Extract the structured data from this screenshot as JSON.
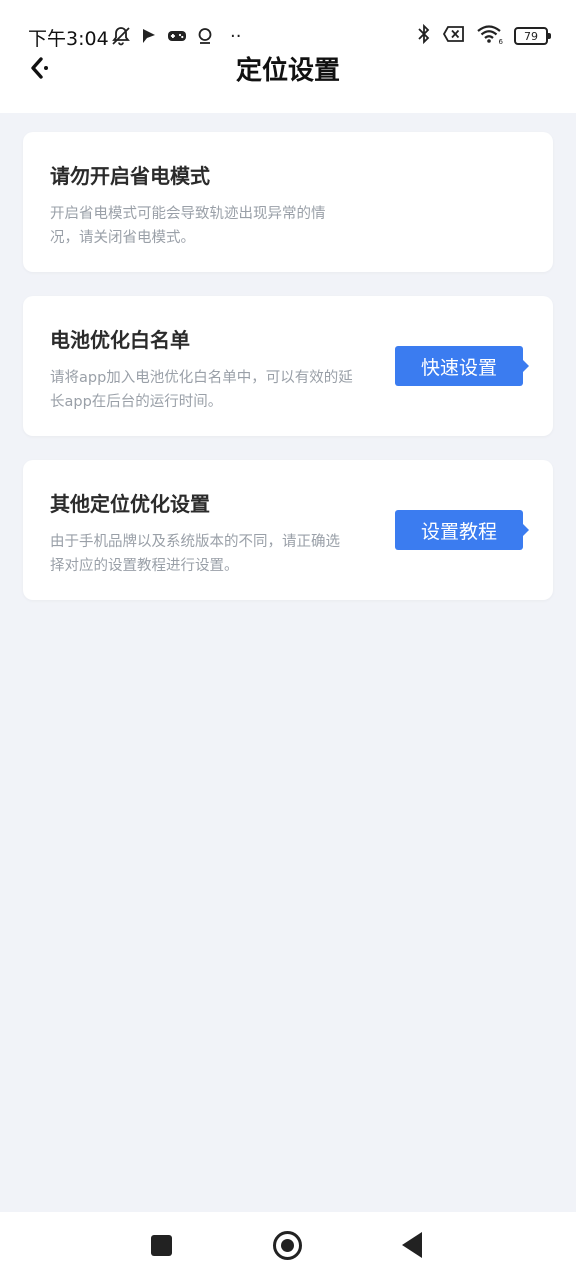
{
  "status_bar": {
    "time": "下午3:04",
    "more": "··",
    "battery_level": "79"
  },
  "header": {
    "title": "定位设置"
  },
  "cards": [
    {
      "title": "请勿开启省电模式",
      "desc_lines": [
        "开启省电模式可能会导致轨迹出现异常的情",
        "况，请关闭省电模式。"
      ]
    },
    {
      "title": "电池优化白名单",
      "desc_lines": [
        "请将app加入电池优化白名单中，可以有效的延",
        "长app在后台的运行时间。"
      ],
      "button_label": "快速设置"
    },
    {
      "title": "其他定位优化设置",
      "desc_lines": [
        "由于手机品牌以及系统版本的不同，请正确选",
        "择对应的设置教程进行设置。"
      ],
      "button_label": "设置教程"
    }
  ],
  "colors": {
    "accent": "#3b7cf0",
    "background": "#f1f3f8",
    "description_text": "#9aa0a8"
  }
}
